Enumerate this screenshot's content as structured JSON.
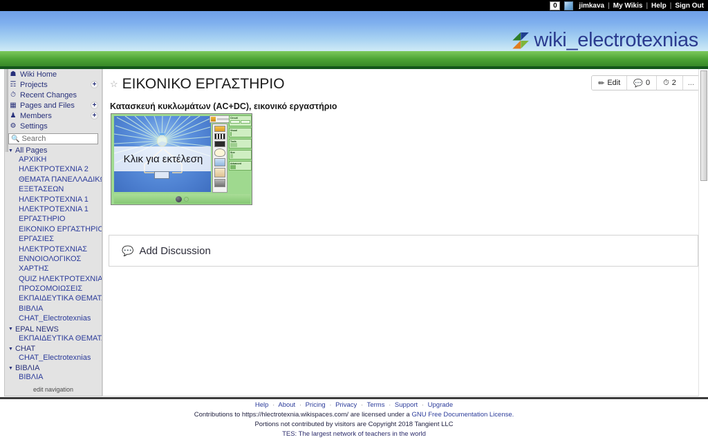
{
  "topbar": {
    "notification_count": "0",
    "avatar": "user-avatar",
    "username": "jimkava",
    "links": [
      "My Wikis",
      "Help",
      "Sign Out"
    ],
    "separator": "|"
  },
  "banner": {
    "wiki_name": "wiki_electrotexnias",
    "logo": "pinwheel-logo",
    "sky_color": "#7fb0ee",
    "grass_color": "#4ca335"
  },
  "sidebar": {
    "nav": [
      {
        "label": "Wiki Home",
        "icon": "home-icon",
        "add": false
      },
      {
        "label": "Projects",
        "icon": "projects-icon",
        "add": true
      },
      {
        "label": "Recent Changes",
        "icon": "clock-icon",
        "add": false
      },
      {
        "label": "Pages and Files",
        "icon": "pages-icon",
        "add": true
      },
      {
        "label": "Members",
        "icon": "person-icon",
        "add": true
      },
      {
        "label": "Settings",
        "icon": "gear-icon",
        "add": false
      }
    ],
    "search": {
      "placeholder": "Search",
      "value": "",
      "icon": "search-icon"
    },
    "sections": [
      {
        "label": "All Pages",
        "expanded": true,
        "items": [
          "ΑΡΧΙΚΗ",
          "ΗΛΕΚΤΡΟΤΕΧΝΙΑ 2",
          "ΘΕΜΑΤΑ ΠΑΝΕΛΛΑΔΙΚΩΝ",
          "ΕΞΕΤΑΣΕΩΝ",
          "ΗΛΕΚΤΡΟΤΕΧΝΙΑ 1",
          "ΗΛΕΚΤΡΟΤΕΧΝΙΑ 1",
          "ΕΡΓΑΣΤΗΡΙΟ",
          "ΕΙΚΟΝΙΚΟ ΕΡΓΑΣΤΗΡΙΟ",
          "ΕΡΓΑΣΙΕΣ",
          "ΗΛΕΚΤΡΟΤΕΧΝΙΑΣ",
          "ΕΝΝΟΙΟΛΟΓΙΚΟΣ",
          "ΧΑΡΤΗΣ",
          "QUIZ ΗΛΕΚΤΡΟΤΕΧΝΙΑΣ",
          "ΠΡΟΣΟΜΟΙΩΣΕΙΣ",
          "ΕΚΠΑΙΔΕΥΤΙΚΑ ΘΕΜΑΤΑ",
          "ΒΙΒΛΙΑ",
          "CHAT_Electrotexnias"
        ]
      },
      {
        "label": "EPAL NEWS",
        "expanded": true,
        "items": [
          "ΕΚΠΑΙΔΕΥΤΙΚΑ ΘΕΜΑΤΑ"
        ]
      },
      {
        "label": "CHAT",
        "expanded": true,
        "items": [
          "CHAT_Electrotexnias"
        ]
      },
      {
        "label": "ΒΙΒΛΙΑ",
        "expanded": true,
        "items": [
          "ΒΙΒΛΙΑ"
        ]
      }
    ],
    "edit_navigation": "edit navigation"
  },
  "page": {
    "title": "ΕΙΚΟΝΙΚΟ ΕΡΓΑΣΤΗΡΙΟ",
    "favorite_icon": "star-icon",
    "subtitle": "Κατασκευή κυκλωμάτων (AC+DC), εικονικό εργαστήριο",
    "actions": [
      {
        "label": "Edit",
        "icon": "pencil-icon"
      },
      {
        "label": "0",
        "icon": "comment-icon"
      },
      {
        "label": "2",
        "icon": "history-icon"
      },
      {
        "label": "...",
        "icon": "more-icon"
      }
    ]
  },
  "widget": {
    "name": "circuit-simulator-embed",
    "overlay_text": "Κλικ για εκτέλεση",
    "play_button": "play-icon",
    "panel_groups": [
      {
        "title": "Circuit",
        "buttons": [
          "Save",
          "Load"
        ]
      },
      {
        "title": "Visual",
        "buttons": [
          "Lifelike"
        ]
      },
      {
        "title": "Tools",
        "buttons": [
          "Voltmeter",
          "Ammeter",
          "Ohms",
          "Grab Bag",
          "Large Circuit"
        ]
      },
      {
        "title": "Size",
        "buttons": [
          "In",
          "Out",
          "Reset"
        ]
      },
      {
        "title": "Advanced",
        "buttons": [
          "Hide All",
          "Show Solution",
          "Check All",
          "Help"
        ]
      }
    ]
  },
  "discussion": {
    "label": "Add Discussion",
    "icon": "comment-bubble-icon"
  },
  "footer": {
    "links": [
      "Help",
      "About",
      "Pricing",
      "Privacy",
      "Terms",
      "Support",
      "Upgrade"
    ],
    "separator": "·",
    "line2_pre": "Contributions to https://hlectrotexnia.wikispaces.com/ are licensed under a ",
    "line2_link": "GNU Free Documentation License.",
    "line3": "Portions not contributed by visitors are Copyright 2018 Tangient LLC",
    "line4": "TES: The largest network of teachers in the world"
  }
}
